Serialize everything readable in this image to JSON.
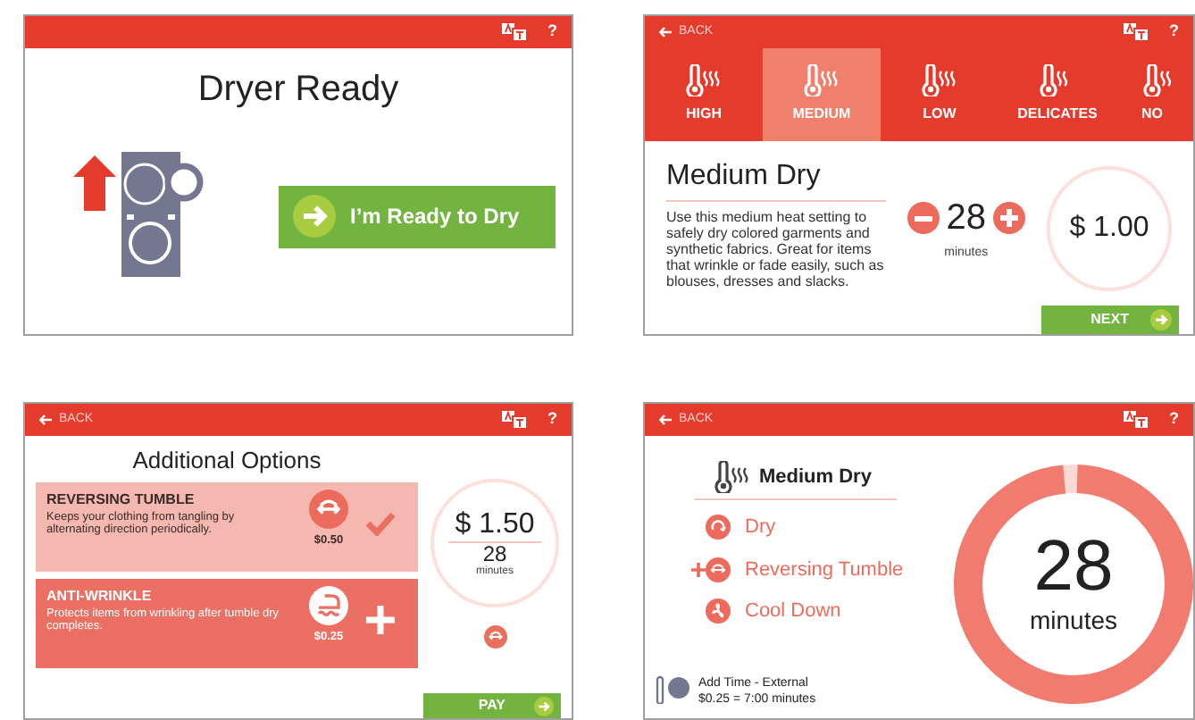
{
  "screens": [
    {
      "kind": "ready",
      "help": "?",
      "title": "Dryer Ready",
      "button": "I’m Ready to Dry"
    },
    {
      "kind": "heat",
      "back": "BACK",
      "help": "?",
      "tabs": [
        {
          "label": "HIGH",
          "selected": false
        },
        {
          "label": "MEDIUM",
          "selected": true
        },
        {
          "label": "LOW",
          "selected": false
        },
        {
          "label": "DELICATES",
          "selected": false
        },
        {
          "label": "NO",
          "selected": false
        }
      ],
      "title": "Medium Dry",
      "description": "Use this medium heat setting to safely dry colored garments and synthetic fabrics. Great for items that wrinkle or fade easily, such as blouses, dresses and slacks.",
      "minutes": "28",
      "minutes_label": "minutes",
      "price": "$ 1.00",
      "next": "NEXT"
    },
    {
      "kind": "options",
      "back": "BACK",
      "help": "?",
      "title": "Additional Options",
      "options": [
        {
          "name": "REVERSING TUMBLE",
          "description": "Keeps your clothing from tangling by alternating direction periodically.",
          "price": "$0.50",
          "kind": "tumble",
          "selected": true
        },
        {
          "name": "ANTI-WRINKLE",
          "description": "Protects items from wrinkling after tumble dry completes.",
          "price": "$0.25",
          "kind": "iron",
          "selected": false
        }
      ],
      "price": "$ 1.50",
      "minutes": "28",
      "minutes_label": "minutes",
      "pay": "PAY"
    },
    {
      "kind": "summary",
      "back": "BACK",
      "help": "?",
      "title": "Medium Dry",
      "steps": [
        {
          "label": "Dry",
          "kind": "dry",
          "added": false
        },
        {
          "label": "Reversing Tumble",
          "kind": "tumble",
          "added": true
        },
        {
          "label": "Cool Down",
          "kind": "cool",
          "added": false
        }
      ],
      "minutes": "28",
      "minutes_label": "minutes",
      "level": 0.98,
      "add_time_title": "Add Time - External",
      "add_time_rate": "$0.25 = 7:00 minutes"
    }
  ]
}
